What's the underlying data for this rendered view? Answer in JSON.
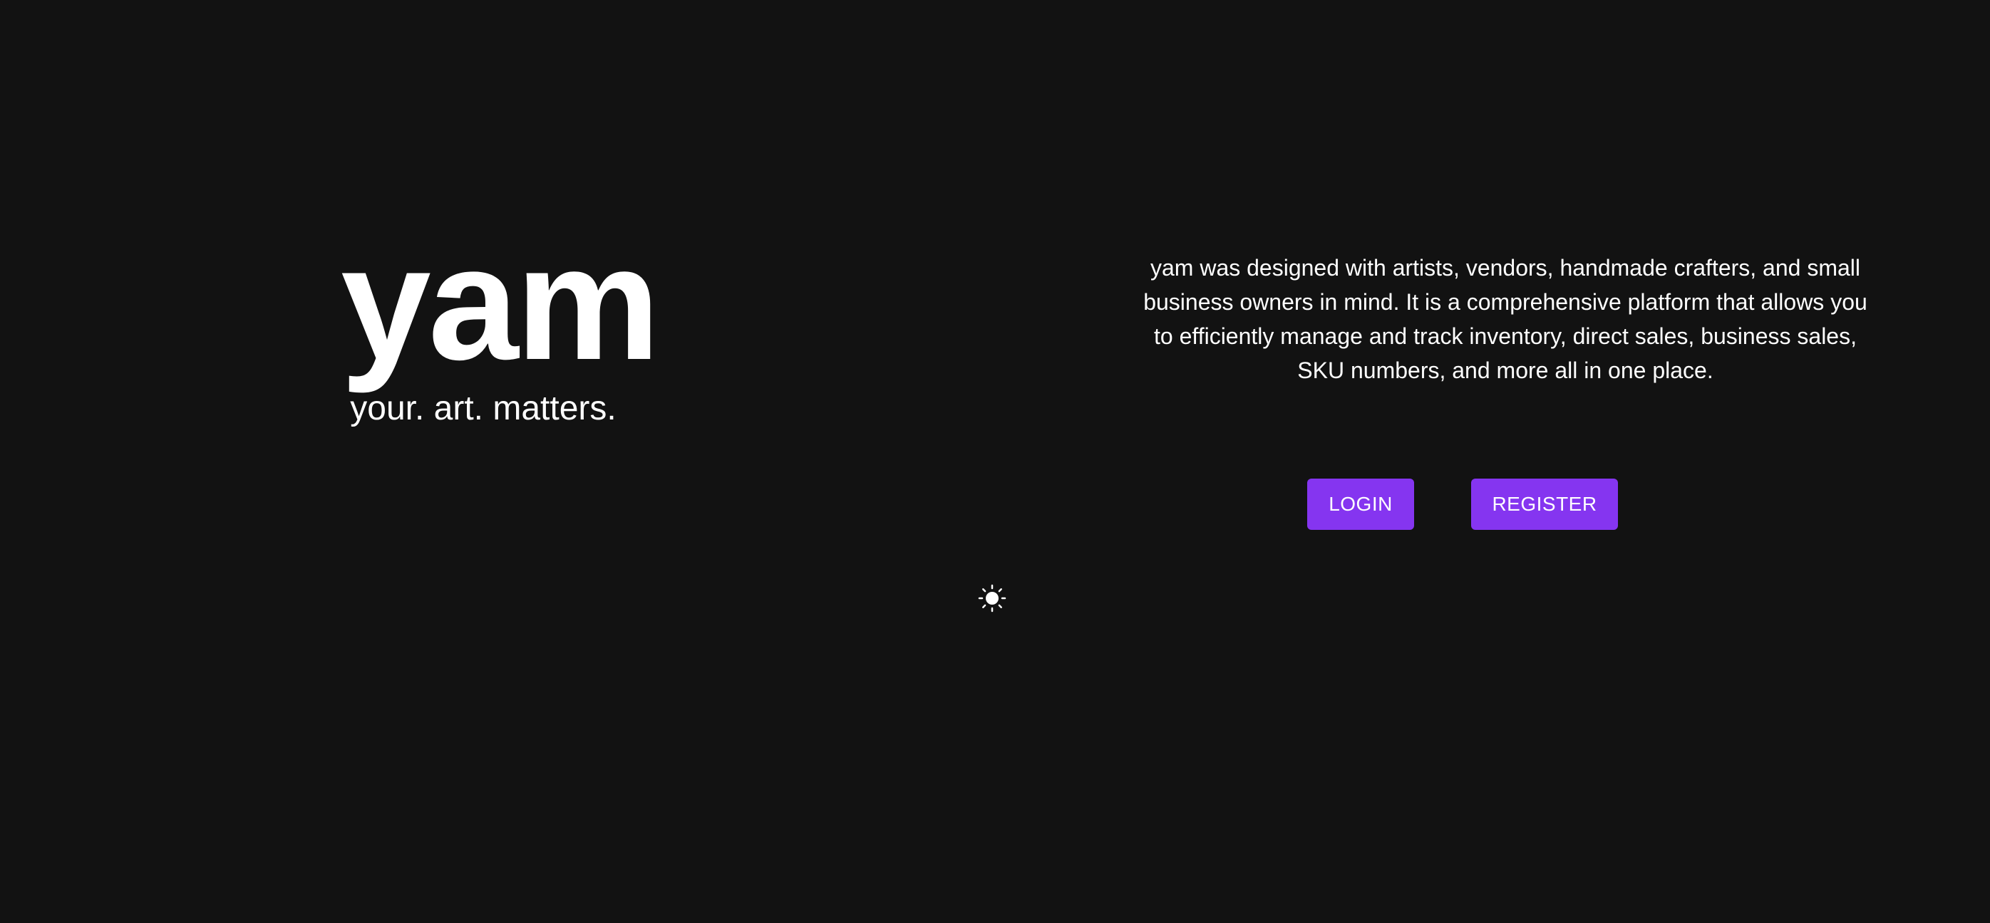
{
  "brand": {
    "logo": "yam",
    "tagline": "your. art. matters."
  },
  "description": "yam was designed with artists, vendors, handmade crafters, and small business owners in mind. It is a comprehensive platform that allows you to efficiently manage and track inventory, direct sales, business sales, SKU numbers, and more all in one place.",
  "actions": {
    "login_label": "LOGIN",
    "register_label": "REGISTER"
  },
  "theme_toggle": {
    "icon": "sun-icon"
  },
  "colors": {
    "background": "#121212",
    "text": "#ffffff",
    "accent": "#8535f0"
  }
}
